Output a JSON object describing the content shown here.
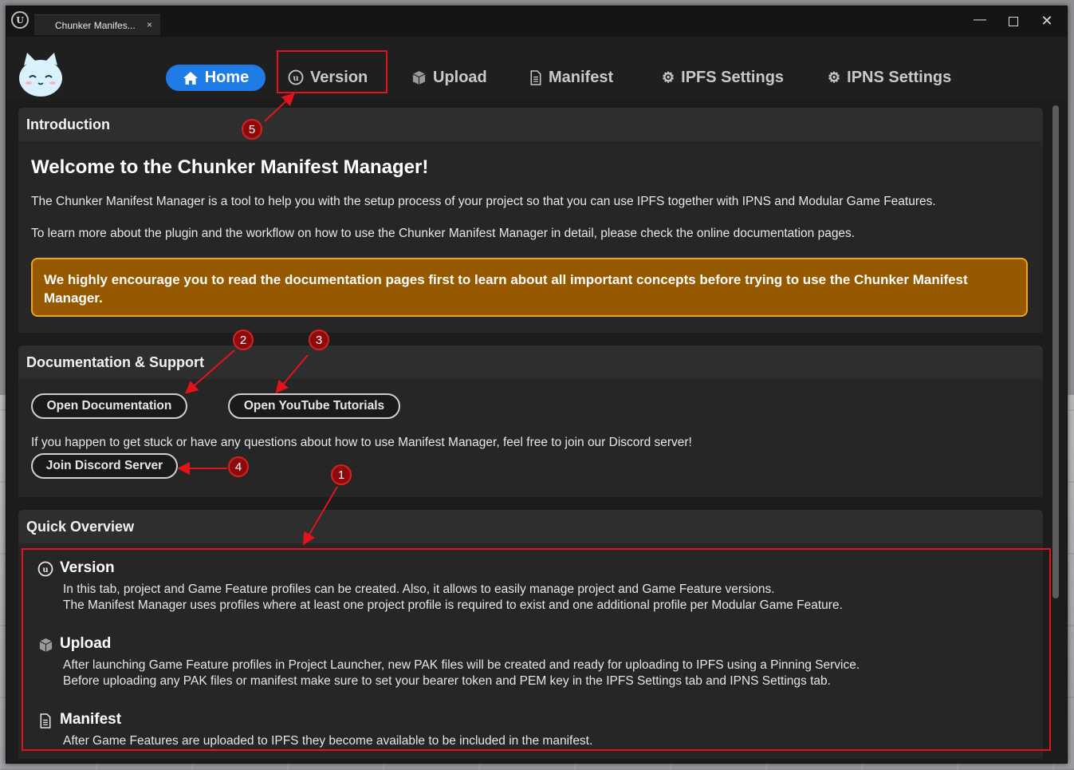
{
  "window": {
    "tab_title": "Chunker Manifes...",
    "tab_close": "×",
    "minimize": "—",
    "close": "✕"
  },
  "nav": {
    "home": "Home",
    "version": "Version",
    "upload": "Upload",
    "manifest": "Manifest",
    "ipfs_settings": "IPFS Settings",
    "ipns_settings": "IPNS Settings"
  },
  "intro": {
    "heading": "Introduction",
    "welcome": "Welcome to the Chunker Manifest Manager!",
    "p1": "The Chunker Manifest Manager is a tool to help you with the setup process of your project so that you can use IPFS together with IPNS and Modular Game Features.",
    "p2": "To learn more about the plugin and the workflow on how to use the Chunker Manifest Manager in detail, please check the online documentation pages.",
    "warning": "We highly encourage you to read the documentation pages first to learn about all important concepts before trying to use the Chunker Manifest Manager."
  },
  "support": {
    "heading": "Documentation & Support",
    "open_docs": "Open Documentation",
    "open_youtube": "Open YouTube Tutorials",
    "discord_text": "If you happen to get stuck or have any questions about how to use Manifest Manager, feel free to join our Discord server!",
    "join_discord": "Join Discord Server"
  },
  "overview": {
    "heading": "Quick Overview",
    "items": [
      {
        "title": "Version",
        "icon": "unreal-icon",
        "lines": [
          "In this tab, project and Game Feature profiles can be created. Also, it allows to easily manage project and Game Feature versions.",
          "The Manifest Manager uses profiles where at least one project profile is required to exist and one additional profile per Modular Game Feature."
        ]
      },
      {
        "title": "Upload",
        "icon": "cube-icon",
        "lines": [
          "After launching Game Feature profiles in Project Launcher, new PAK files will be created and ready for uploading to IPFS using a Pinning Service.",
          "Before uploading any PAK files or manifest make sure to set your bearer token and PEM key in the IPFS Settings tab and IPNS Settings tab."
        ]
      },
      {
        "title": "Manifest",
        "icon": "document-icon",
        "lines": [
          "After Game Features are uploaded to IPFS they become available to be included in the manifest."
        ]
      }
    ]
  },
  "annotations": [
    "1",
    "2",
    "3",
    "4",
    "5"
  ],
  "colors": {
    "accent": "#1f7be6",
    "warning_bg": "#965900",
    "warning_border": "#f0a21e",
    "annotation": "#e3131b"
  }
}
